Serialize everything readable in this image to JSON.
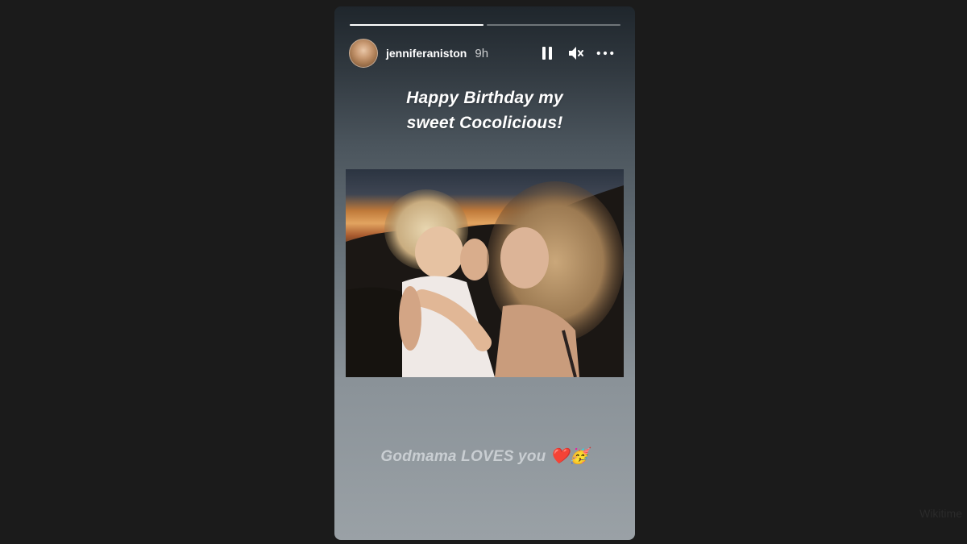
{
  "story": {
    "progress": [
      1,
      0
    ],
    "user": {
      "username": "jenniferaniston",
      "time_ago": "9h"
    },
    "controls": {
      "pause_icon": "pause-icon",
      "mute_icon": "muted-speaker-icon",
      "more_icon": "more-horizontal-icon"
    },
    "caption_top": [
      "Happy Birthday my",
      "sweet Cocolicious!"
    ],
    "caption_bottom": "Godmama LOVES you ❤️🥳"
  },
  "colors": {
    "background": "#1b1b1b",
    "text": "#ffffff",
    "caption_bottom": "#c9ced2"
  },
  "watermark": "Wikitime"
}
